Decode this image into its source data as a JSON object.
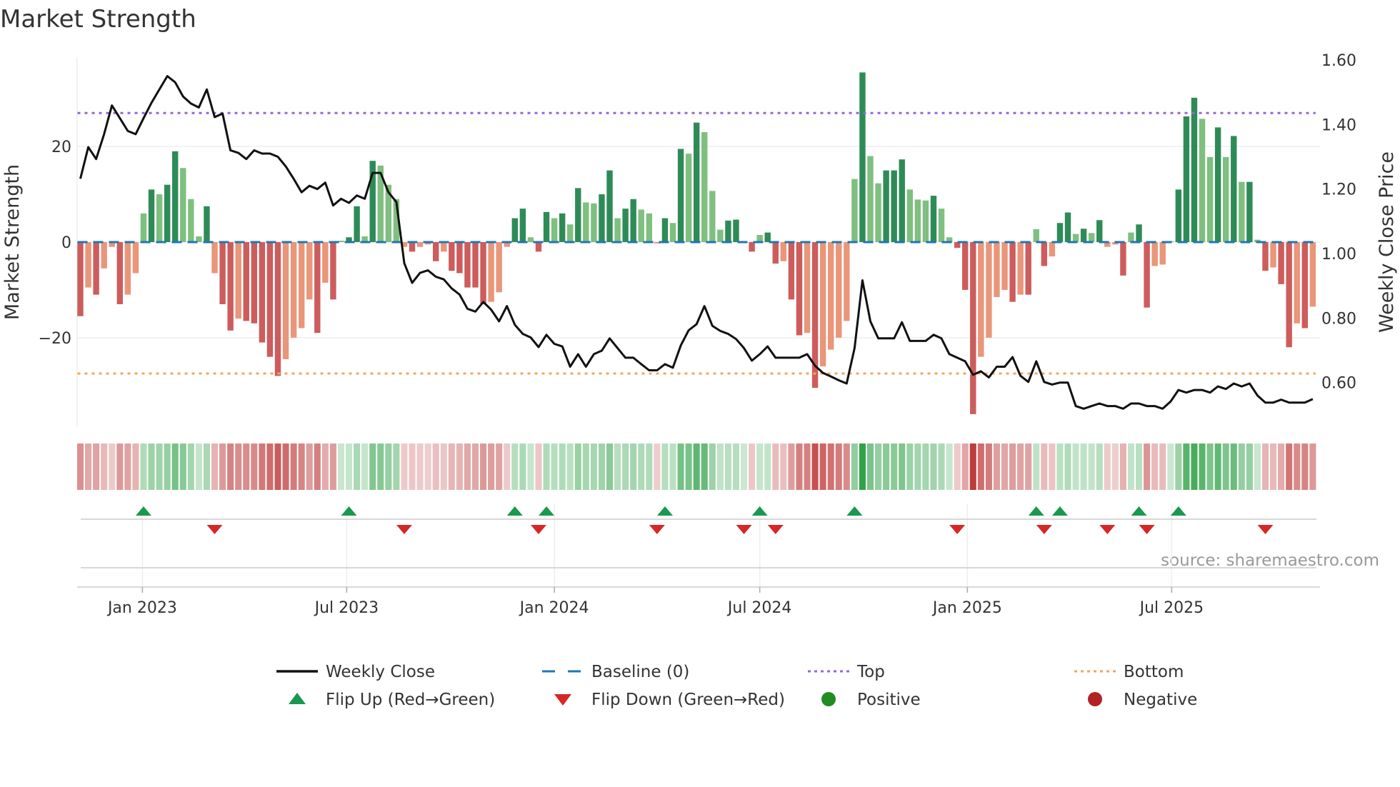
{
  "chart_data": {
    "type": "bar",
    "title": "Market Strength",
    "ylabel": "Market Strength",
    "y2label": "Weekly Close Price",
    "source": "source: sharemaestro.com",
    "frequency": "weekly",
    "start_date": "2022-11-07",
    "ylim": [
      -38.7,
      38.7
    ],
    "y2lim": [
      0.462,
      1.609
    ],
    "yticks": [
      20,
      0,
      -20
    ],
    "ytick_labels": [
      "20",
      "0",
      "−20"
    ],
    "y2ticks": [
      1.6,
      1.4,
      1.2,
      1.0,
      0.8,
      0.6
    ],
    "y2tick_labels": [
      "1.60",
      "1.40",
      "1.20",
      "1.00",
      "0.80",
      "0.60"
    ],
    "xticks": [
      {
        "date": "2023-01-01",
        "label": "Jan 2023"
      },
      {
        "date": "2023-07-01",
        "label": "Jul 2023"
      },
      {
        "date": "2024-01-01",
        "label": "Jan 2024"
      },
      {
        "date": "2024-07-01",
        "label": "Jul 2024"
      },
      {
        "date": "2025-01-01",
        "label": "Jan 2025"
      },
      {
        "date": "2025-07-01",
        "label": "Jul 2025"
      }
    ],
    "top_level": 27,
    "bottom_level": -27.5,
    "baseline": 0,
    "grid": true,
    "legend_position": "bottom",
    "strength": [
      -15.5,
      -9.5,
      -11,
      -5.5,
      -1,
      -13,
      -11,
      -6.5,
      6,
      11,
      10,
      12,
      19,
      15.5,
      9,
      1.2,
      7.5,
      -6.5,
      -13,
      -18.5,
      -16,
      -16.5,
      -17,
      -21,
      -24,
      -28,
      -24.5,
      -20,
      -18,
      -12,
      -19,
      -8.5,
      -12,
      0.3,
      1,
      7.5,
      1.2,
      17,
      16,
      12,
      9,
      -1,
      -2,
      -1,
      -0.5,
      -4,
      -2,
      -6,
      -6.5,
      -9.5,
      -9.5,
      -13,
      -12.5,
      -10.5,
      -1,
      5,
      7,
      1,
      -2,
      6.3,
      5,
      6,
      3.7,
      11.3,
      8.3,
      8.1,
      10,
      15,
      5,
      7,
      9,
      6.8,
      6,
      -0.3,
      5,
      4,
      19.5,
      18.5,
      25,
      23,
      10.7,
      2.6,
      4.5,
      4.7,
      0.2,
      -2,
      1.5,
      2,
      -4.5,
      -4,
      -12,
      -19.5,
      -19,
      -30.5,
      -26,
      -22.5,
      -20,
      -16.5,
      13.2,
      35.5,
      18,
      12.3,
      15,
      15,
      17.3,
      11,
      8.9,
      8.7,
      9.7,
      7,
      1,
      -1.2,
      -10,
      -36,
      -24,
      -20,
      -11.5,
      -10,
      -12.5,
      -11,
      -11,
      2.7,
      -5,
      -3,
      4,
      6.2,
      1.7,
      2.8,
      1.9,
      4.6,
      -1,
      -0.5,
      -7,
      2,
      3.7,
      -13.7,
      -5,
      -4.7,
      0.2,
      11,
      26.3,
      30.2,
      25.8,
      17.8,
      24,
      17.8,
      22.2,
      12.6,
      12.6,
      0.5,
      -6,
      -5.3,
      -8.8,
      -22,
      -17,
      -18,
      -13.5
    ],
    "weekly_close": [
      1.232,
      1.33,
      1.293,
      1.37,
      1.459,
      1.42,
      1.38,
      1.37,
      1.42,
      1.467,
      1.509,
      1.55,
      1.531,
      1.487,
      1.465,
      1.453,
      1.509,
      1.423,
      1.434,
      1.32,
      1.312,
      1.293,
      1.32,
      1.31,
      1.31,
      1.3,
      1.27,
      1.232,
      1.19,
      1.21,
      1.2,
      1.22,
      1.149,
      1.17,
      1.157,
      1.18,
      1.17,
      1.25,
      1.25,
      1.19,
      1.16,
      0.97,
      0.909,
      0.94,
      0.948,
      0.928,
      0.92,
      0.892,
      0.873,
      0.829,
      0.82,
      0.85,
      0.826,
      0.79,
      0.837,
      0.779,
      0.751,
      0.74,
      0.71,
      0.748,
      0.72,
      0.712,
      0.649,
      0.688,
      0.649,
      0.688,
      0.699,
      0.737,
      0.707,
      0.677,
      0.677,
      0.657,
      0.638,
      0.638,
      0.657,
      0.646,
      0.715,
      0.762,
      0.781,
      0.837,
      0.776,
      0.76,
      0.751,
      0.735,
      0.707,
      0.668,
      0.688,
      0.712,
      0.677,
      0.677,
      0.677,
      0.677,
      0.688,
      0.652,
      0.63,
      0.619,
      0.607,
      0.597,
      0.707,
      0.917,
      0.79,
      0.737,
      0.737,
      0.737,
      0.787,
      0.729,
      0.729,
      0.729,
      0.748,
      0.737,
      0.688,
      0.677,
      0.666,
      0.624,
      0.635,
      0.616,
      0.649,
      0.649,
      0.679,
      0.621,
      0.602,
      0.666,
      0.602,
      0.594,
      0.6,
      0.6,
      0.527,
      0.519,
      0.527,
      0.535,
      0.527,
      0.527,
      0.519,
      0.535,
      0.535,
      0.527,
      0.527,
      0.519,
      0.541,
      0.577,
      0.569,
      0.577,
      0.577,
      0.569,
      0.588,
      0.58,
      0.597,
      0.588,
      0.597,
      0.56,
      0.538,
      0.538,
      0.547,
      0.538,
      0.538,
      0.538,
      0.549
    ],
    "flip_up_weeks": [
      8,
      34,
      55,
      59,
      74,
      86,
      98,
      121,
      124,
      134,
      139
    ],
    "flip_down_weeks": [
      17,
      41,
      58,
      73,
      84,
      88,
      111,
      122,
      130,
      135,
      150
    ],
    "colors": {
      "pos_strong": "#2e8b57",
      "pos_weak": "#7fbf7f",
      "neg_strong": "#cd5c5c",
      "neg_weak": "#e9967a",
      "close": "#111111",
      "baseline": "#1f77b4",
      "top": "#9467d8",
      "bottom": "#f4a460",
      "flip_up": "#1a9850",
      "flip_down": "#d62728",
      "positive": "#228b22",
      "negative": "#b22222"
    },
    "legend": [
      {
        "key": "close",
        "label": "Weekly Close"
      },
      {
        "key": "baseline",
        "label": "Baseline (0)"
      },
      {
        "key": "top",
        "label": "Top"
      },
      {
        "key": "bottom",
        "label": "Bottom"
      },
      {
        "key": "flip_up",
        "label": "Flip Up (Red→Green)"
      },
      {
        "key": "flip_down",
        "label": "Flip Down (Green→Red)"
      },
      {
        "key": "positive",
        "label": "Positive"
      },
      {
        "key": "negative",
        "label": "Negative"
      }
    ]
  }
}
